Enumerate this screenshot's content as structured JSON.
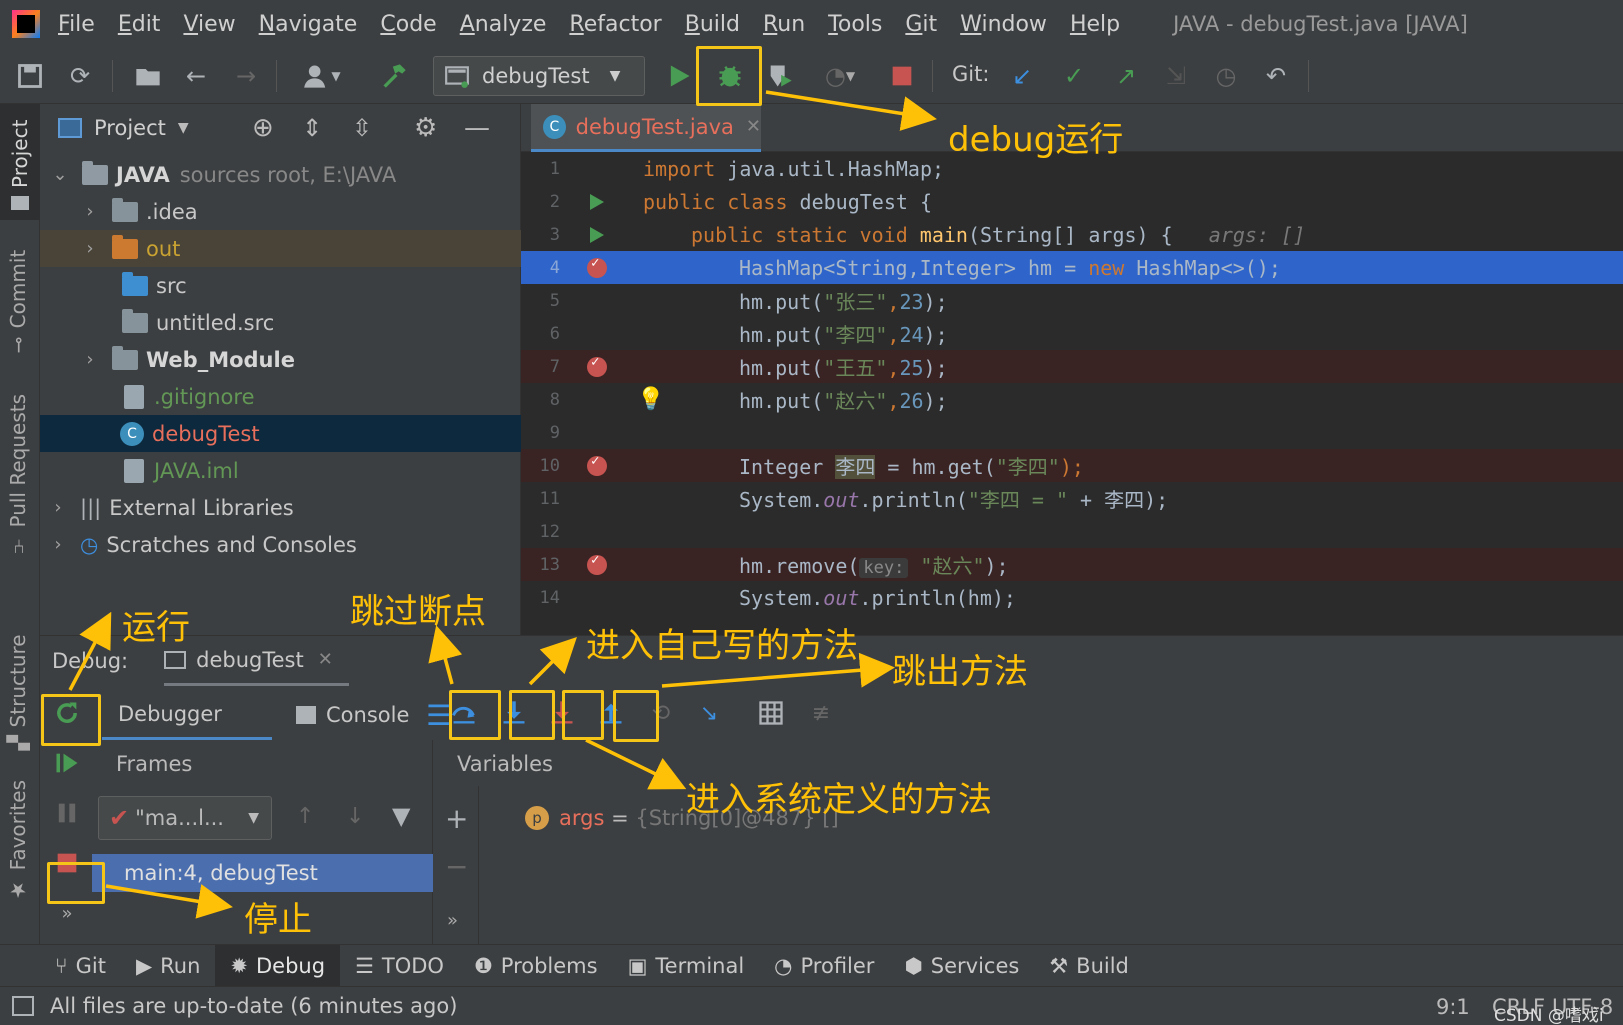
{
  "menu": {
    "items": [
      "File",
      "Edit",
      "View",
      "Navigate",
      "Code",
      "Analyze",
      "Refactor",
      "Build",
      "Run",
      "Tools",
      "Git",
      "Window",
      "Help"
    ],
    "window_title": "JAVA - debugTest.java [JAVA]"
  },
  "toolbar": {
    "run_config": "debugTest",
    "git_label": "Git:"
  },
  "left_stripe": {
    "tabs": [
      "Project",
      "Commit",
      "Pull Requests",
      "Structure",
      "Favorites"
    ]
  },
  "project": {
    "header": "Project",
    "root": {
      "name": "JAVA",
      "detail": "sources root,  E:\\JAVA"
    },
    "items": [
      ".idea",
      "out",
      "src",
      "untitled.src",
      "Web_Module",
      ".gitignore",
      "debugTest",
      "JAVA.iml"
    ],
    "external": "External Libraries",
    "scratches": "Scratches and Consoles"
  },
  "editor": {
    "tab": "debugTest.java",
    "lines": {
      "n1": "1",
      "n2": "2",
      "n3": "3",
      "n4": "4",
      "n5": "5",
      "n6": "6",
      "n7": "7",
      "n8": "8",
      "n9": "9",
      "n10": "10",
      "n11": "11",
      "n12": "12",
      "n13": "13",
      "n14": "14"
    },
    "code": {
      "l1_kw": "import",
      "l1_rest": " java.util.HashMap;",
      "l2_kw": "public class",
      "l2_rest": " debugTest {",
      "l3_kw": "public static void",
      "l3_main": " main",
      "l3_rest": "(String[] args) {",
      "l3_hint": "args: []",
      "l4_a": "HashMap<String,Integer> hm = ",
      "l4_kw": "new",
      "l4_b": " HashMap<>();",
      "l5_a": "hm.put(",
      "l5_s": "\"张三\"",
      "l5_n": "23",
      "l5_b": ");",
      "l6_a": "hm.put(",
      "l6_s": "\"李四\"",
      "l6_n": "24",
      "l6_b": ");",
      "l7_a": "hm.put(",
      "l7_s": "\"王五\"",
      "l7_n": "25",
      "l7_b": ");",
      "l8_a": "hm.put(",
      "l8_s": "\"赵六\"",
      "l8_n": "26",
      "l8_b": ");",
      "l10_a": "Integer ",
      "l10_v": "李四",
      "l10_b": " = hm.get(",
      "l10_s": "\"李四\"",
      "l10_c": ");",
      "l11_a": "System.",
      "l11_f": "out",
      "l11_b": ".println(",
      "l11_s": "\"李四 = \"",
      "l11_c": " + 李四);",
      "l13_a": "hm.remove(",
      "l13_hint": "key:",
      "l13_s": "\"赵六\"",
      "l13_b": ");",
      "l14_a": "System.",
      "l14_f": "out",
      "l14_b": ".println(hm);"
    }
  },
  "debug": {
    "label": "Debug:",
    "session": "debugTest",
    "tab_debugger": "Debugger",
    "tab_console": "Console",
    "frames_label": "Frames",
    "variables_label": "Variables",
    "thread": "\"ma...l...",
    "frame": "main:4, debugTest",
    "var_name": "args",
    "var_eq": " = ",
    "var_value": "{String[0]@487} []"
  },
  "toolwindows": [
    "Git",
    "Run",
    "Debug",
    "TODO",
    "Problems",
    "Terminal",
    "Profiler",
    "Services",
    "Build"
  ],
  "status": {
    "message": "All files are up-to-date (6 minutes ago)",
    "position": "9:1",
    "line_sep": "CRLF",
    "encoding": "UTF-8",
    "watermark": "CSDN @嗜戏i"
  },
  "annotations": {
    "debug_run": "debug运行",
    "run": "运行",
    "skip_breakpoint": "跳过断点",
    "step_into_own": "进入自己写的方法",
    "step_out": "跳出方法",
    "step_into_system": "进入系统定义的方法",
    "stop": "停止"
  },
  "colors": {
    "accent": "#ffc107",
    "selection": "#2f65ca",
    "breakpoint": "#c75450",
    "run_green": "#499c54"
  }
}
